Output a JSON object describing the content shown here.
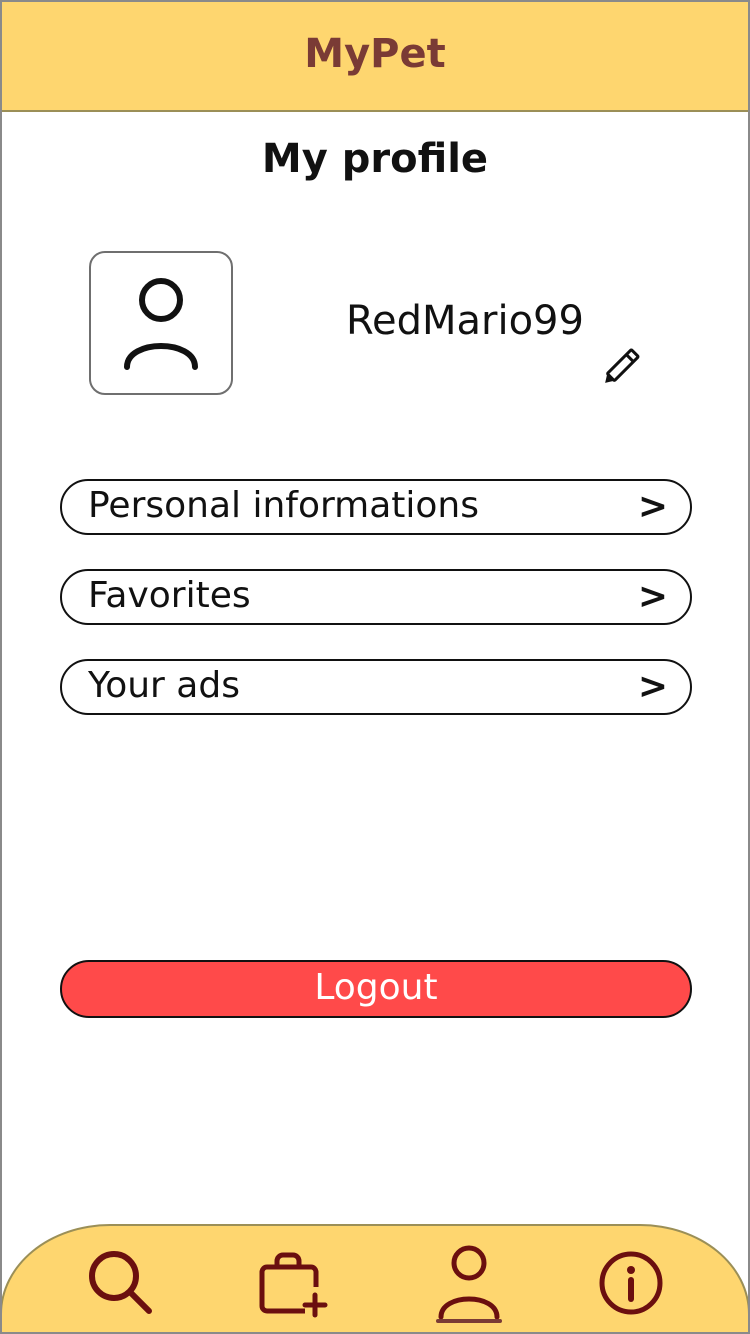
{
  "header": {
    "title": "MyPet"
  },
  "profile": {
    "page_title": "My profile",
    "avatar_icon": "user-icon",
    "username": "RedMario99",
    "edit_icon": "pencil-icon"
  },
  "menu": {
    "items": [
      {
        "label": "Personal informations",
        "chevron": ">"
      },
      {
        "label": "Favorites",
        "chevron": ">"
      },
      {
        "label": "Your ads",
        "chevron": ">"
      }
    ]
  },
  "logout": {
    "label": "Logout"
  },
  "bottom_nav": {
    "items": [
      {
        "icon": "search-icon",
        "active": false
      },
      {
        "icon": "bag-add-icon",
        "active": false
      },
      {
        "icon": "user-icon",
        "active": true
      },
      {
        "icon": "info-icon",
        "active": false
      }
    ]
  },
  "colors": {
    "header_bg": "#fed66f",
    "brand_text": "#7a3b35",
    "nav_icon": "#6b0f0f",
    "logout_bg": "#ff4a4a",
    "text": "#111111"
  }
}
